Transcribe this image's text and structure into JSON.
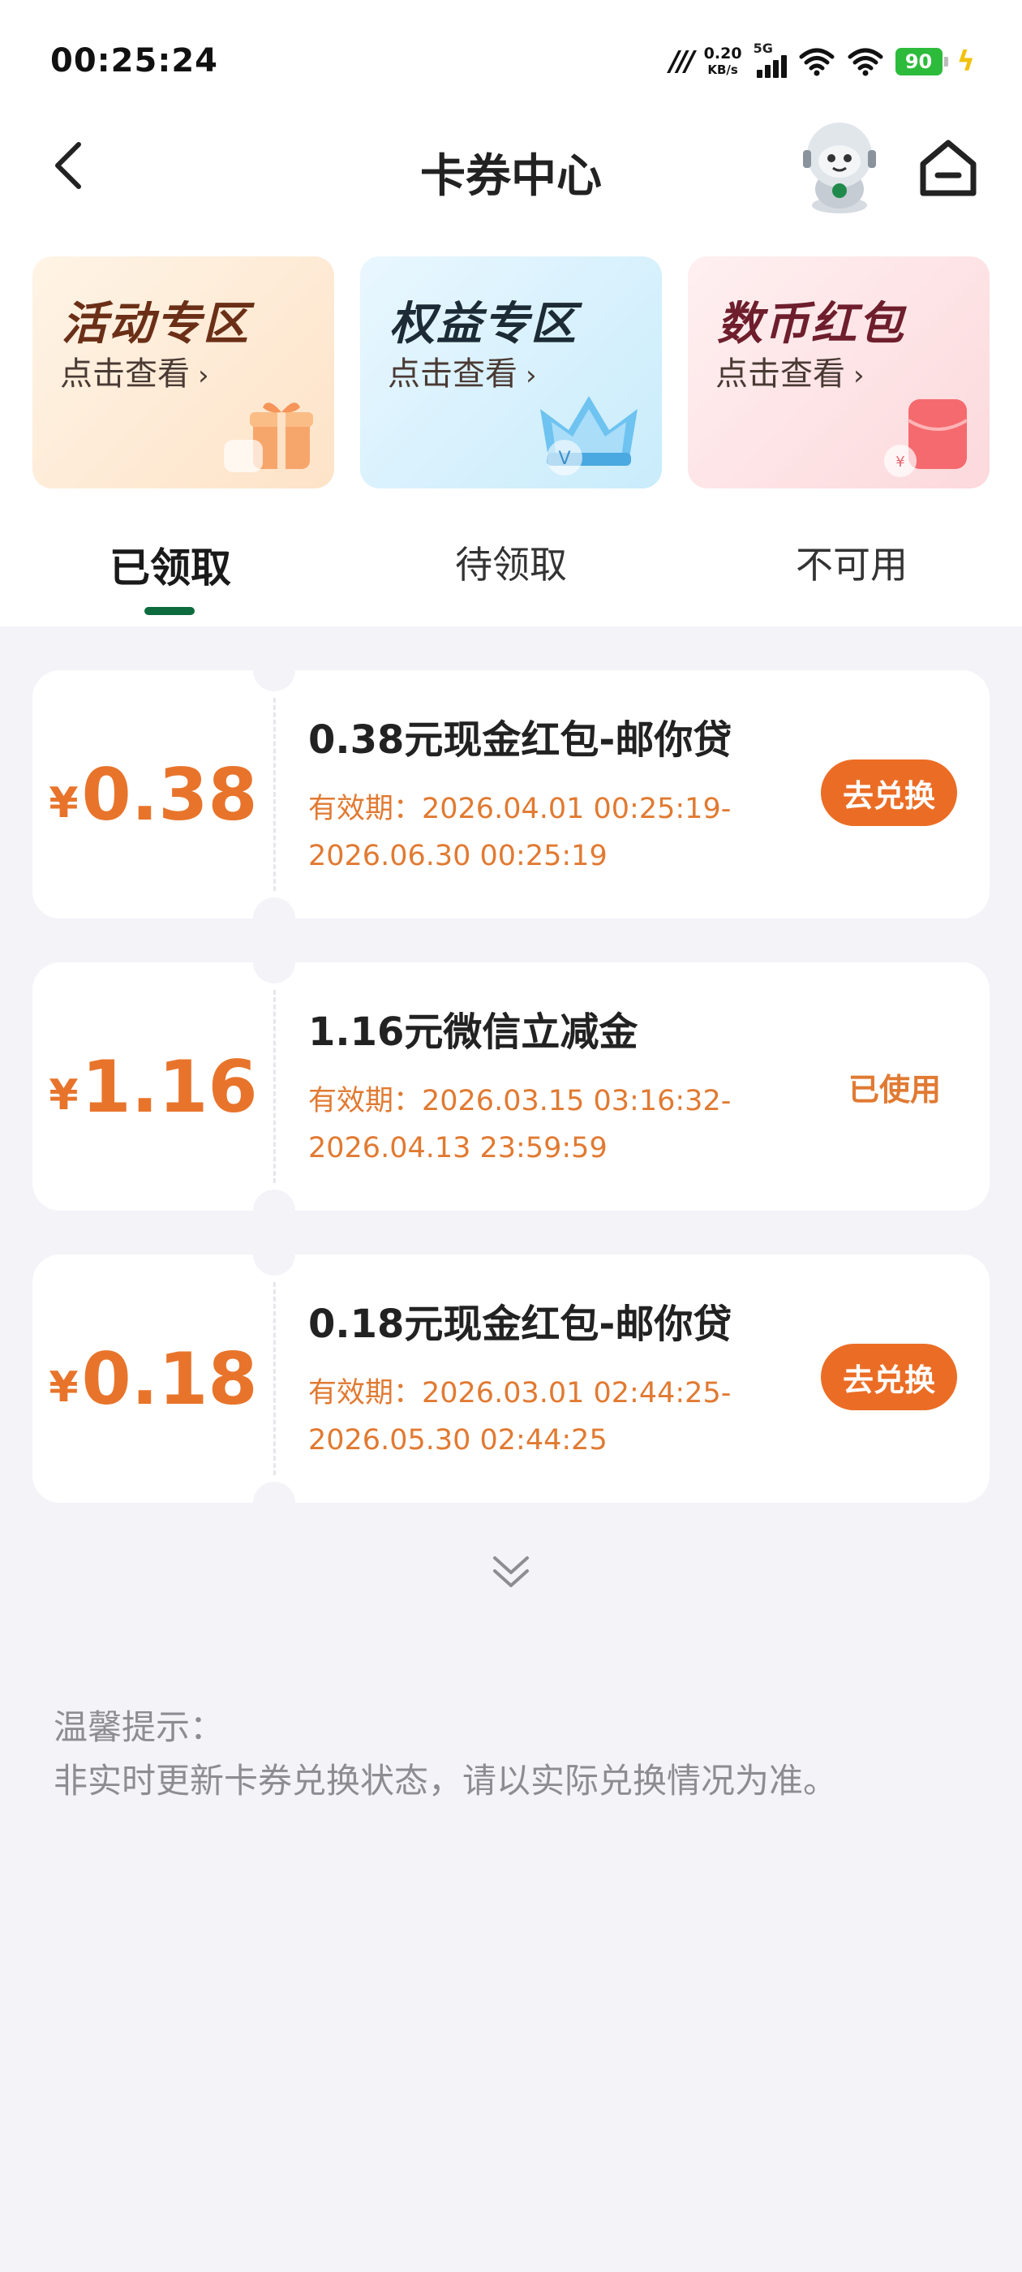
{
  "status_bar": {
    "time": "00:25:24",
    "net_speed_value": "0.20",
    "net_speed_unit": "KB/s",
    "network": "5G",
    "battery": "90",
    "icons": [
      "network-m-icon",
      "signal-icon",
      "wifi-icon",
      "battery-icon",
      "charging-icon"
    ]
  },
  "nav": {
    "title": "卡券中心",
    "icons": [
      "back-icon",
      "mascot-avatar",
      "home-icon"
    ]
  },
  "banners": [
    {
      "title": "活动专区",
      "subtitle": "点击查看",
      "icon": "gift-icon"
    },
    {
      "title": "权益专区",
      "subtitle": "点击查看",
      "icon": "crown-icon"
    },
    {
      "title": "数币红包",
      "subtitle": "点击查看",
      "icon": "red-packet-icon"
    }
  ],
  "tabs": [
    {
      "label": "已领取",
      "active": true
    },
    {
      "label": "待领取",
      "active": false
    },
    {
      "label": "不可用",
      "active": false
    }
  ],
  "coupons": [
    {
      "currency": "¥",
      "amount": "0.38",
      "name": "0.38元现金红包-邮你贷",
      "validity_line1": "有效期：2026.04.01 00:25:19-",
      "validity_line2": "2026.06.30 00:25:19",
      "action": "去兑换"
    },
    {
      "currency": "¥",
      "amount": "1.16",
      "name": "1.16元微信立减金",
      "validity_line1": "有效期：2026.03.15 03:16:32-",
      "validity_line2": "2026.04.13 23:59:59",
      "status": "已使用"
    },
    {
      "currency": "¥",
      "amount": "0.18",
      "name": "0.18元现金红包-邮你贷",
      "validity_line1": "有效期：2026.03.01 02:44:25-",
      "validity_line2": "2026.05.30 02:44:25",
      "action": "去兑换"
    }
  ],
  "tips": {
    "title": "温馨提示：",
    "text": "非实时更新卡券兑换状态，请以实际兑换情况为准。"
  },
  "colors": {
    "accent_green": "#0d6b3d",
    "coupon_orange": "#e8742b",
    "button_orange": "#eb6d25",
    "page_bg": "#f4f3f8"
  }
}
